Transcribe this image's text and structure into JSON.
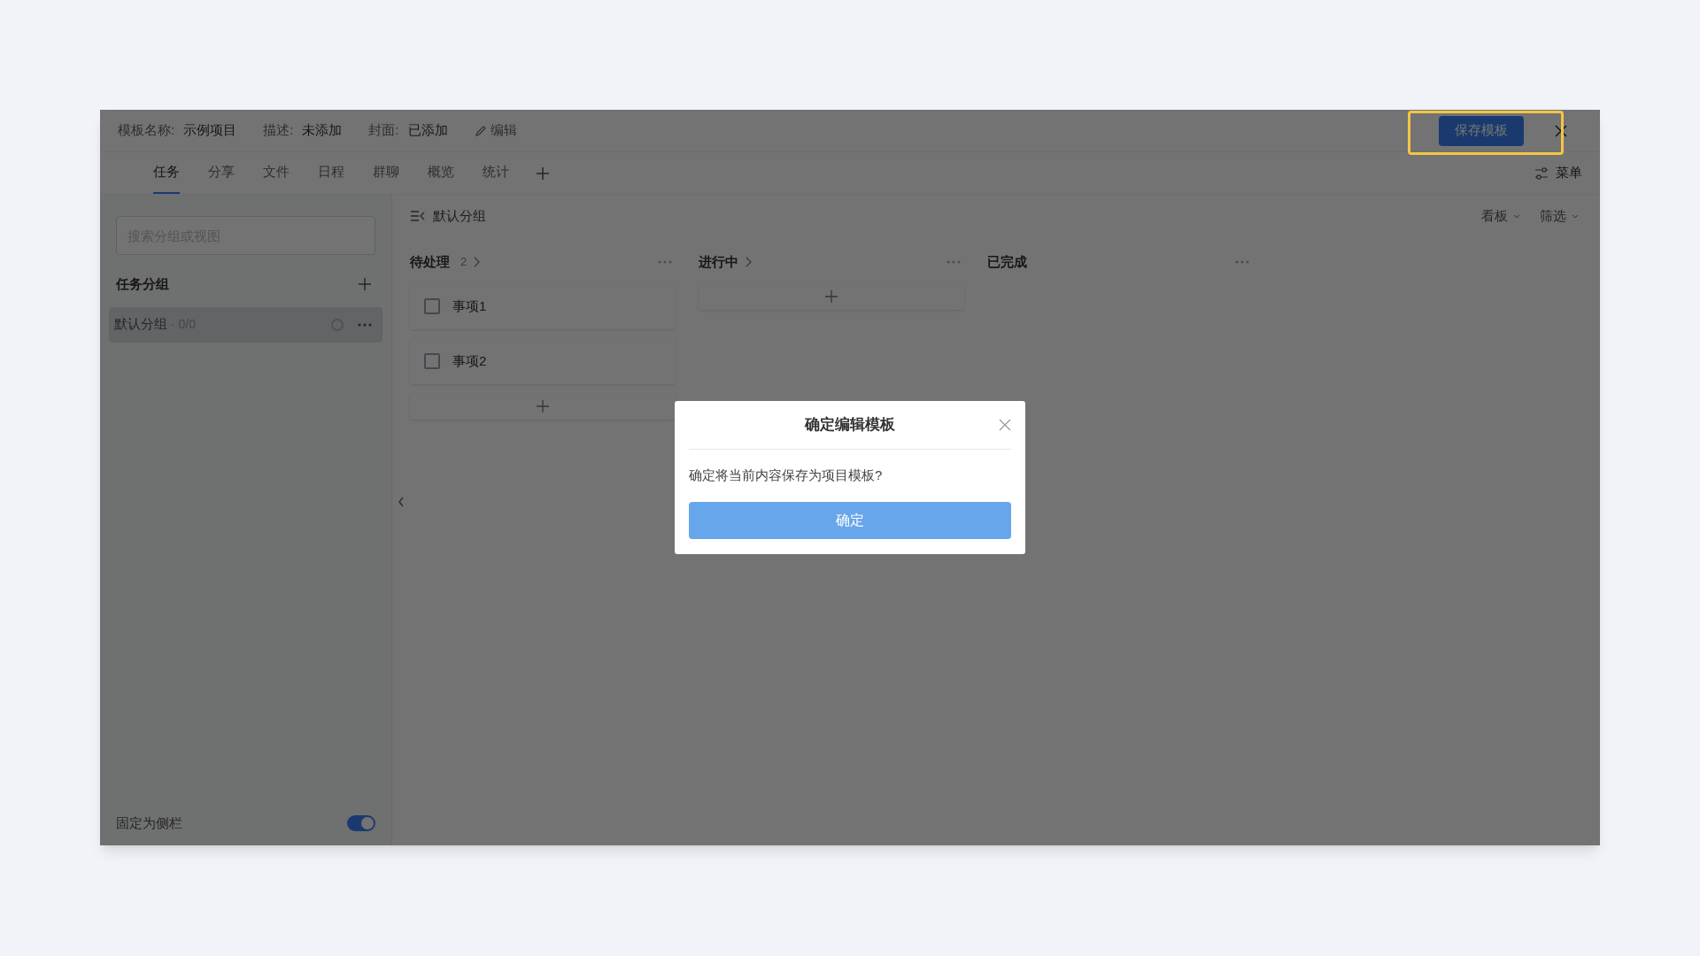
{
  "header": {
    "fields": [
      {
        "label": "模板名称:",
        "value": "示例项目"
      },
      {
        "label": "描述:",
        "value": "未添加"
      },
      {
        "label": "封面:",
        "value": "已添加"
      }
    ],
    "edit_link": "编辑",
    "save_button": {
      "label": "保存模板",
      "highlighted": true
    }
  },
  "tabs": [
    {
      "label": "任务",
      "selected": true
    },
    {
      "label": "分享",
      "selected": false
    },
    {
      "label": "文件",
      "selected": false
    },
    {
      "label": "日程",
      "selected": false
    },
    {
      "label": "群聊",
      "selected": false
    },
    {
      "label": "概览",
      "selected": false
    },
    {
      "label": "统计",
      "selected": false
    }
  ],
  "menu": "菜单",
  "sidebar": {
    "search": {
      "placeholder": "搜索分组或视图"
    },
    "section_title": "任务分组",
    "groups": [
      {
        "name": "默认分组",
        "count": "· 0/0",
        "selected": true
      }
    ],
    "pin": {
      "label": "固定为侧栏",
      "on": true
    }
  },
  "breadcrumb": "默认分组",
  "view_controls": [
    "看板",
    "筛选"
  ],
  "columns": [
    {
      "title": "待处理",
      "count": "2",
      "expandable": true,
      "add_button": true,
      "cards": [
        {
          "title": "事项1",
          "checked": false
        },
        {
          "title": "事项2",
          "checked": false
        }
      ]
    },
    {
      "title": "进行中",
      "expandable": true,
      "add_button": true
    },
    {
      "title": "已完成",
      "expandable": false,
      "add_button": false
    }
  ],
  "dialog": {
    "title": "确定编辑模板",
    "message": "确定将当前内容保存为项目模板?",
    "confirm": "确定"
  }
}
